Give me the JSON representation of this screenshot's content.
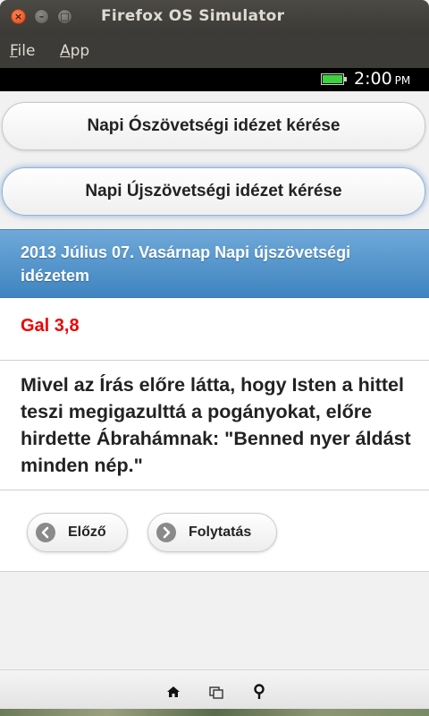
{
  "window": {
    "title": "Firefox OS Simulator",
    "close_glyph": "×",
    "minimize_glyph": "–",
    "maximize_glyph": "□"
  },
  "menubar": {
    "items": [
      {
        "label": "File",
        "mnemonic": "F",
        "rest": "ile"
      },
      {
        "label": "App",
        "mnemonic": "A",
        "rest": "pp"
      }
    ]
  },
  "statusbar": {
    "time": "2:00",
    "ampm": "PM",
    "battery_color": "#3ed13e"
  },
  "app": {
    "buttons": {
      "old_testament": "Napi Ószövetségi idézet kérése",
      "new_testament": "Napi Újszövetségi idézet kérése"
    },
    "header": "2013 Július 07. Vasárnap Napi újszövetségi idézetem",
    "reference": "Gal 3,8",
    "verse": "Mivel az Írás előre látta, hogy Isten a hittel teszi megigazulttá a pogányokat, előre hirdette Ábrahámnak: \"Benned nyer áldást minden nép.\"",
    "nav": {
      "prev": "Előző",
      "next": "Folytatás"
    },
    "colors": {
      "header_blue": "#4a8ac5",
      "reference_red": "#ee0000"
    }
  },
  "toolbar": {
    "icons": [
      "home-icon",
      "windows-icon",
      "location-pin-icon"
    ]
  }
}
